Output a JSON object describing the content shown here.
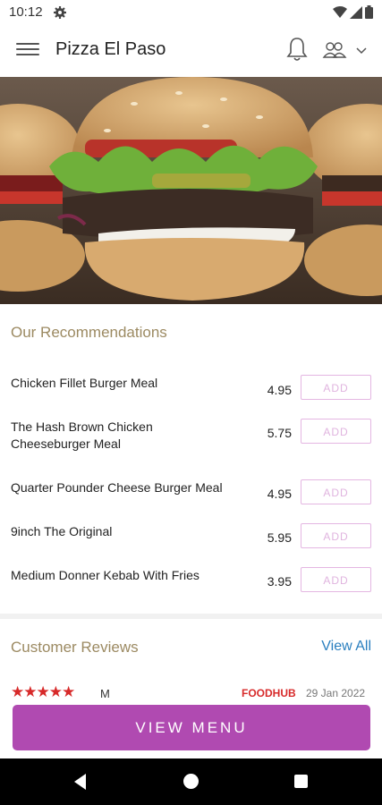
{
  "status_bar": {
    "time": "10:12",
    "icons": [
      "gear-icon",
      "wifi-icon",
      "signal-icon",
      "battery-icon"
    ]
  },
  "app_bar": {
    "title": "Pizza El Paso",
    "icons": [
      "menu-icon",
      "bell-icon",
      "user-group-icon",
      "chevron-down-icon"
    ]
  },
  "recommendations": {
    "title": "Our Recommendations",
    "add_label": "ADD",
    "items": [
      {
        "name": "Chicken Fillet Burger Meal",
        "price": "4.95"
      },
      {
        "name": "The Hash Brown Chicken Cheeseburger Meal",
        "price": "5.75"
      },
      {
        "name": "Quarter Pounder Cheese Burger Meal",
        "price": "4.95"
      },
      {
        "name": "9inch The Original",
        "price": "5.95"
      },
      {
        "name": "Medium Donner Kebab With Fries",
        "price": "3.95"
      }
    ]
  },
  "reviews": {
    "title": "Customer Reviews",
    "view_all": "View All",
    "first": {
      "stars": "★★★★★",
      "rating": 5,
      "reviewer": "M",
      "source": "FOODHUB",
      "date": "29 Jan 2022"
    }
  },
  "cta": {
    "label": "VIEW MENU"
  },
  "colors": {
    "accent": "#b04ab1",
    "section_title": "#9c8a62",
    "link": "#2a7fbf",
    "star": "#d72a2a"
  }
}
